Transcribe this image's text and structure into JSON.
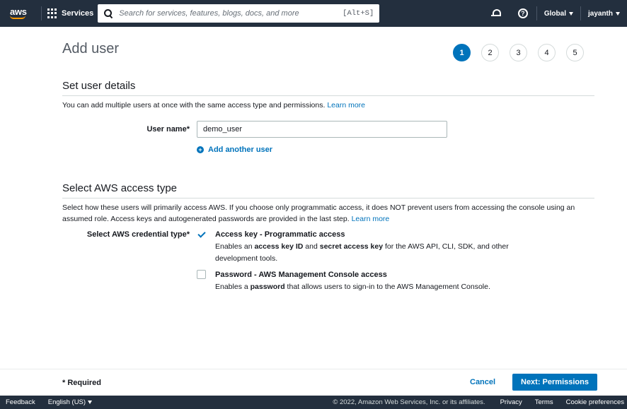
{
  "nav": {
    "logo": "aws",
    "services_label": "Services",
    "search_placeholder": "Search for services, features, blogs, docs, and more",
    "search_shortcut": "[Alt+S]",
    "notifications_icon": "bell-icon",
    "help_icon": "help-circle-icon",
    "region_label": "Global",
    "user_label": "jayanth"
  },
  "page": {
    "title": "Add user",
    "steps": [
      "1",
      "2",
      "3",
      "4",
      "5"
    ],
    "active_step": "1"
  },
  "user_details": {
    "heading": "Set user details",
    "description": "You can add multiple users at once with the same access type and permissions.",
    "learn_more": "Learn more",
    "user_name_label": "User name*",
    "user_name_value": "demo_user",
    "add_another_label": "Add another user"
  },
  "access_type": {
    "heading": "Select AWS access type",
    "description": "Select how these users will primarily access AWS. If you choose only programmatic access, it does NOT prevent users from accessing the console using an assumed role. Access keys and autogenerated passwords are provided in the last step.",
    "learn_more": "Learn more",
    "credential_label": "Select AWS credential type*",
    "options": [
      {
        "title": "Access key - Programmatic access",
        "desc_pre": "Enables an ",
        "desc_b1": "access key ID",
        "desc_mid": " and ",
        "desc_b2": "secret access key",
        "desc_post": " for the AWS API, CLI, SDK, and other development tools.",
        "checked": true
      },
      {
        "title": "Password - AWS Management Console access",
        "desc_pre": "Enables a ",
        "desc_b1": "password",
        "desc_post": " that allows users to sign-in to the AWS Management Console.",
        "checked": false
      }
    ]
  },
  "actions": {
    "required_note": "* Required",
    "cancel_label": "Cancel",
    "next_label": "Next: Permissions"
  },
  "footer": {
    "feedback": "Feedback",
    "language": "English (US)",
    "copyright": "© 2022, Amazon Web Services, Inc. or its affiliates.",
    "privacy": "Privacy",
    "terms": "Terms",
    "cookies": "Cookie preferences"
  },
  "colors": {
    "nav_bg": "#232f3e",
    "accent": "#0073bb",
    "brand_orange": "#ff9900"
  }
}
